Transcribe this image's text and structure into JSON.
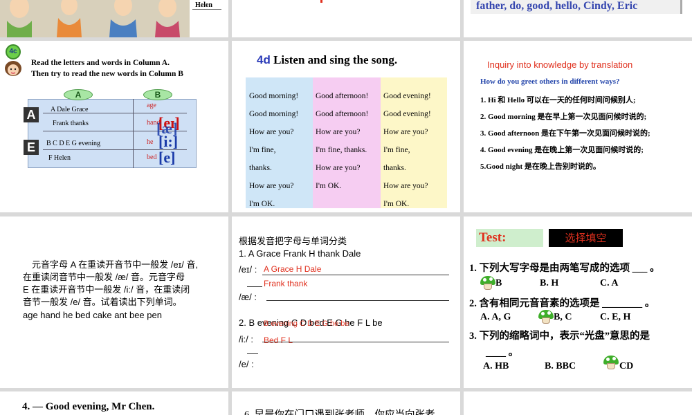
{
  "p1": {
    "name_label": "Helen"
  },
  "p2": {},
  "p3": {
    "words": "father,  do,   good,  hello,  Cindy,  Eric"
  },
  "p4": {
    "badge": "4c",
    "instr1": "Read the letters and words in Column A.",
    "instr2": "Then try to read the new words in Column B",
    "colA": "A",
    "colB": "B",
    "rowA_letter": "A",
    "rowE_letter": "E",
    "rowA_1": "A   Dale     Grace",
    "rowA_2": "Frank      thanks",
    "rowE_1": "B   C   D    E    G   evening",
    "rowE_2": "F   Helen",
    "b_age": "age",
    "b_hand": "hand",
    "b_he": "he",
    "b_bed": "bed",
    "ph1": "[eɪ]",
    "ph2": "[æ]",
    "ph3": "[i:]",
    "ph4": "[e]"
  },
  "p5": {
    "num": "4d",
    "title": " Listen and sing the song.",
    "col1": [
      "Good morning!",
      "Good morning!",
      "How are you?",
      "I'm fine,",
      "thanks.",
      "How are you?",
      "I'm OK."
    ],
    "col2": [
      "Good afternoon!",
      "Good afternoon!",
      "How are you?",
      "I'm fine, thanks.",
      "How are you?",
      "I'm OK."
    ],
    "col3": [
      "Good evening!",
      "Good evening!",
      "How are you?",
      "I'm fine,",
      "thanks.",
      "How are you?",
      "I'm OK."
    ],
    "colors": {
      "c1": "#cfe6f7",
      "c2": "#f6cdf2",
      "c3": "#fdf7c8"
    }
  },
  "p6": {
    "title": "Inquiry into knowledge by translation",
    "question": "How do you greet others in different ways?",
    "items": [
      "1. Hi  和   Hello  可以在一天的任何时间问候别人;",
      "2. Good morning  是在早上第一次见面问候时说的;",
      "3. Good afternoon  是在下午第一次见面问候时说的;",
      "4. Good evening  是在晚上第一次见面问候时说的;",
      "5.Good night  是在晚上告别时说的。"
    ]
  },
  "p7": {
    "line1": "元音字母 A 在重读开音节中一般发 /eɪ/ 音,",
    "line2": "在重读闭音节中一般发 /æ/  音。元音字母",
    "line3": "E 在重读开音节中一般发 /i:/ 音，在重读闭",
    "line4": "音节一般发 /e/ 音。试着读出下列单词。",
    "words": "age  hand  he   bed   cake   ant   bee   pen"
  },
  "p8": {
    "title": "根据发音把字母与单词分类",
    "list1": "1. A  Grace   Frank  H   thank    Dale",
    "ei_label": "/eɪ/ :",
    "ei_ans": "A  Grace    H    Dale",
    "ae_ans": "Frank   thank",
    "ae_label": "/æ/ :",
    "list2": "2. B   evening  C   D  bed   E   G   he   F  L  be",
    "list2_overlay": "B  evening  C  D  E  G  he  be",
    "i_label": "/i:/ :",
    "i_ans2": "Bed  F  L",
    "e_label": "/e/ :"
  },
  "p9": {
    "test": "Test:",
    "choose": "选择填空",
    "q1": "1.  下列大写字母是由两笔写成的选项  ___ 。",
    "q1_opts": [
      "B",
      "B. H",
      "C. A"
    ],
    "q2": "2.  含有相同元音音素的选项是  ________ 。",
    "q2_opts": [
      "A. A, G",
      "B, C",
      "C. E, H"
    ],
    "q3": "3.  下列的缩略词中，表示“光盘”意思的是",
    "q3b": "____ 。",
    "q3_opts": [
      "A. HB",
      "B. BBC",
      "CD"
    ]
  },
  "p10": {
    "text": "4. — Good evening, Mr Chen."
  },
  "p11": {
    "text": "6. 早晨你在门口遇到张老师，你应当向张老"
  },
  "p12": {}
}
